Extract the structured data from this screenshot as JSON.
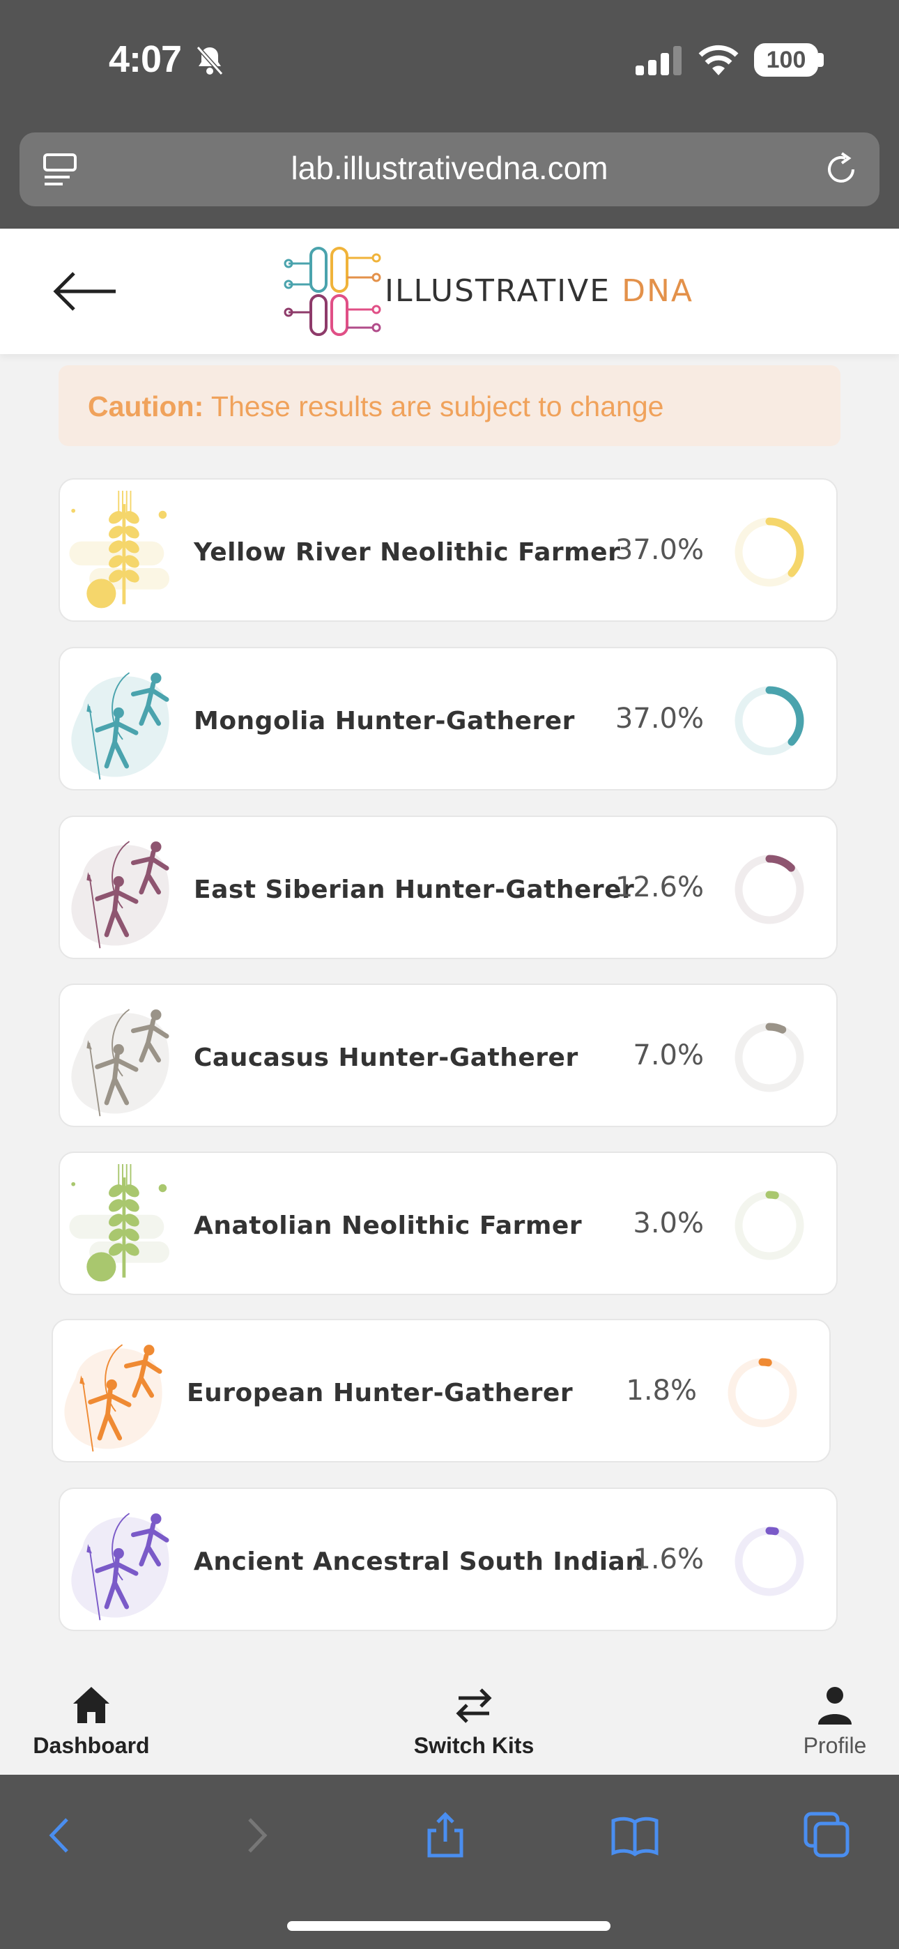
{
  "status": {
    "time": "4:07",
    "battery": "100"
  },
  "browser": {
    "url": "lab.illustrativedna.com"
  },
  "header": {
    "logo_main": "ILLUSTRATIVE",
    "logo_accent": "DNA"
  },
  "caution": {
    "label": "Caution:",
    "text": "These results are subject to change"
  },
  "results": [
    {
      "name": "Yellow River Neolithic Farmer",
      "percent": "37.0%",
      "value": 37.0,
      "color": "#f5d66b",
      "track": "#fbf6e4",
      "icon": "wheat-icon"
    },
    {
      "name": "Mongolia Hunter-Gatherer",
      "percent": "37.0%",
      "value": 37.0,
      "color": "#4aa3ad",
      "track": "#e5f2f3",
      "icon": "archer-icon"
    },
    {
      "name": "East Siberian Hunter-Gatherer",
      "percent": "12.6%",
      "value": 12.6,
      "color": "#8e5570",
      "track": "#f0eced",
      "icon": "archer-icon"
    },
    {
      "name": "Caucasus Hunter-Gatherer",
      "percent": "7.0%",
      "value": 7.0,
      "color": "#9a9388",
      "track": "#f1f0ef",
      "icon": "archer-icon"
    },
    {
      "name": "Anatolian Neolithic Farmer",
      "percent": "3.0%",
      "value": 3.0,
      "color": "#a9c76e",
      "track": "#f3f5ee",
      "icon": "wheat-icon"
    },
    {
      "name": "European Hunter-Gatherer",
      "percent": "1.8%",
      "value": 1.8,
      "color": "#ef8a33",
      "track": "#fdf1e8",
      "icon": "archer-icon"
    },
    {
      "name": "Ancient Ancestral South Indian",
      "percent": "1.6%",
      "value": 1.6,
      "color": "#7a5ac8",
      "track": "#efecf8",
      "icon": "archer-icon"
    }
  ],
  "nav": {
    "dashboard": "Dashboard",
    "switch_kits": "Switch Kits",
    "profile": "Profile"
  }
}
